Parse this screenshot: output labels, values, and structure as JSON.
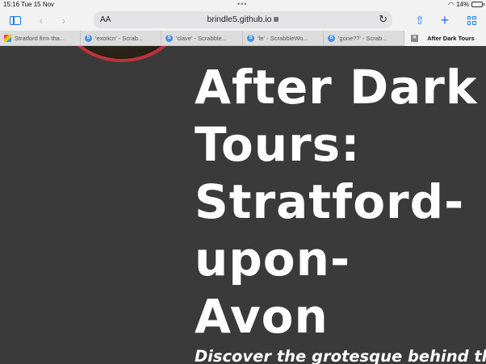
{
  "status_bar": {
    "time": "15:16",
    "date": "Tue 15 Nov",
    "battery_percent": "14%",
    "battery_level": 0.14
  },
  "toolbar": {
    "text_size_label": "AA",
    "url": "brindle5.github.io"
  },
  "tabs": [
    {
      "title": "Stratford firm tha...",
      "icon": "multicolor-favicon",
      "active": false
    },
    {
      "title": "'exoticn' - Scrab...",
      "icon": "s-favicon",
      "active": false
    },
    {
      "title": "'clave' - Scrabble...",
      "icon": "s-favicon",
      "active": false
    },
    {
      "title": "'fe' - ScrabbleWo...",
      "icon": "s-favicon",
      "active": false
    },
    {
      "title": "'gone??' - Scrab...",
      "icon": "s-favicon",
      "active": false
    },
    {
      "title": "After Dark Tours",
      "icon": "close-icon",
      "active": true
    }
  ],
  "page": {
    "title_lines": [
      "After Dark",
      "Tours:",
      "Stratford-",
      "upon-",
      "Avon"
    ],
    "subtitle": "Discover the grotesque behind the"
  },
  "colors": {
    "page_background": "#3a3a3a",
    "accent": "#1e78f0",
    "logo_ring": "#c0333a"
  }
}
